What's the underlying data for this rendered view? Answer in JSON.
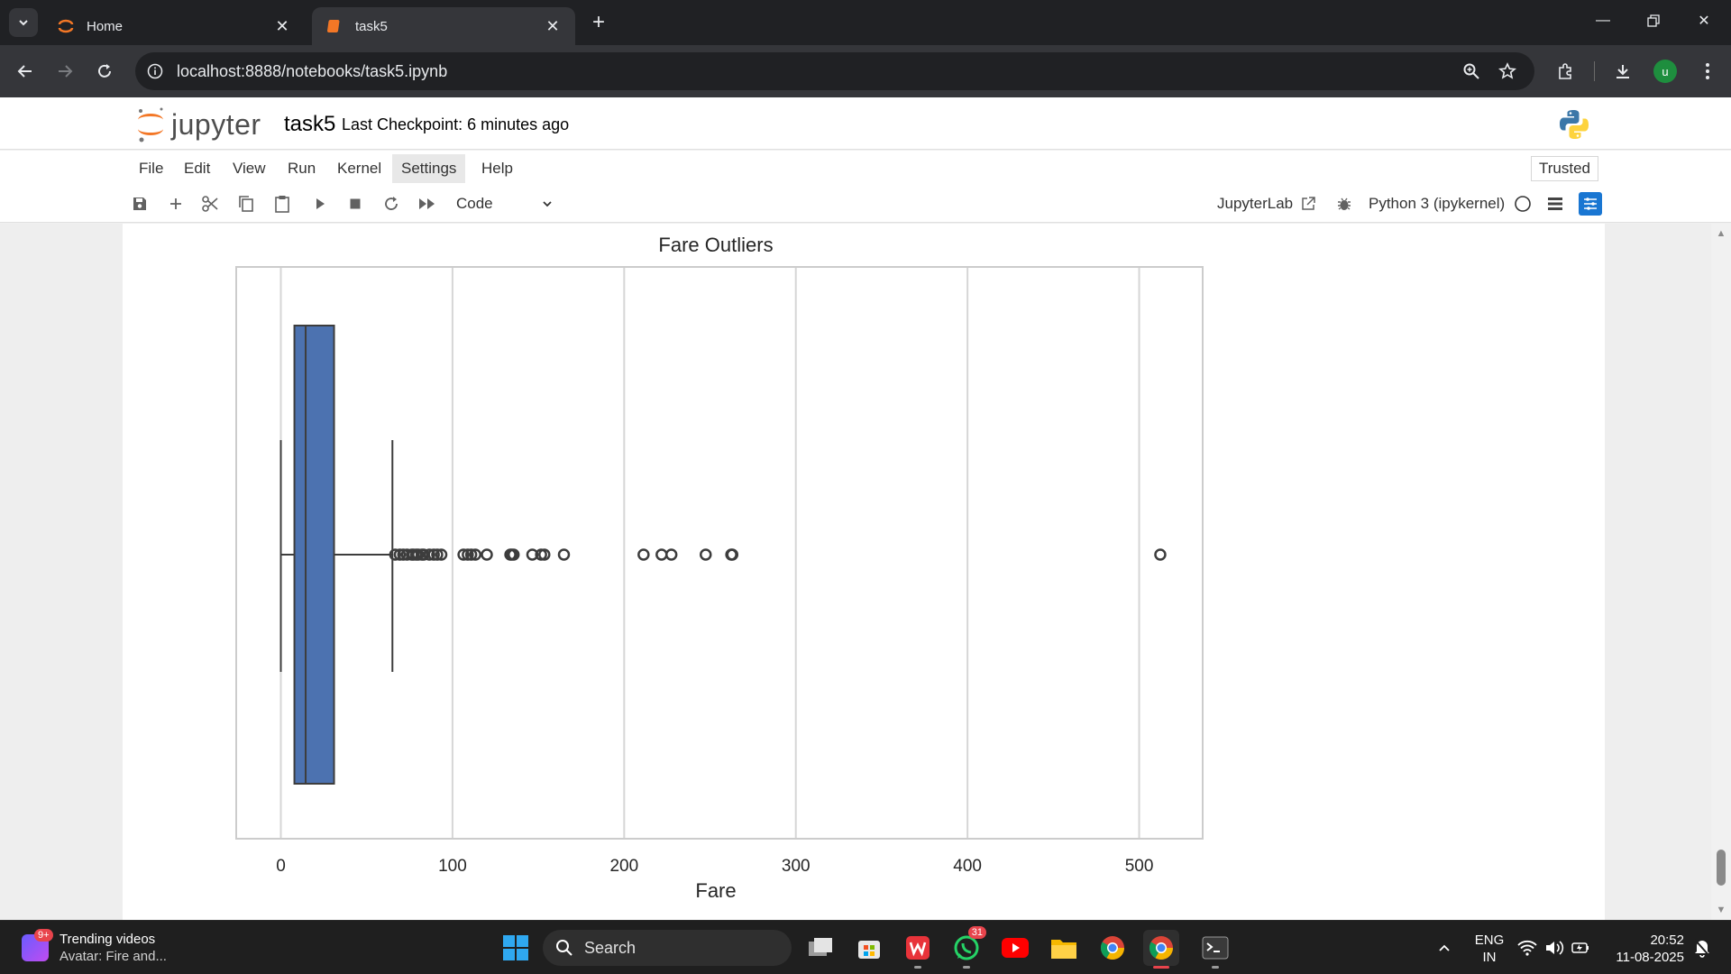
{
  "browser": {
    "tabs": [
      {
        "title": "Home",
        "active": false
      },
      {
        "title": "task5",
        "active": true
      }
    ],
    "url": "localhost:8888/notebooks/task5.ipynb"
  },
  "jupyter": {
    "logo_text": "jupyter",
    "notebook_name": "task5",
    "checkpoint": "Last Checkpoint: 6 minutes ago",
    "menu": [
      "File",
      "Edit",
      "View",
      "Run",
      "Kernel",
      "Settings",
      "Help"
    ],
    "trusted": "Trusted",
    "cell_type": "Code",
    "jupyterlab_label": "JupyterLab",
    "kernel": "Python 3 (ipykernel)"
  },
  "chart_data": {
    "type": "boxplot",
    "title": "Fare Outliers",
    "xlabel": "Fare",
    "ylabel": "",
    "xlim": [
      -26,
      537
    ],
    "xticks": [
      0,
      100,
      200,
      300,
      400,
      500
    ],
    "grid": "vertical",
    "box_color": "#4c72b0",
    "box": {
      "whisker_low": 0,
      "q1": 7.9,
      "median": 14.45,
      "q3": 31.0,
      "whisker_high": 65.0
    },
    "outliers": [
      66.6,
      69.3,
      71.3,
      73.5,
      76.3,
      77.3,
      78.9,
      80.0,
      82.2,
      83.2,
      86.5,
      89.1,
      91.1,
      93.5,
      106.4,
      108.9,
      110.9,
      113.3,
      120.0,
      133.7,
      134.5,
      135.6,
      146.5,
      151.6,
      153.5,
      164.9,
      211.3,
      221.8,
      227.5,
      247.5,
      262.4,
      263.0,
      512.3
    ]
  },
  "taskbar": {
    "widget_title": "Trending videos",
    "widget_sub": "Avatar: Fire and...",
    "widget_badge": "9+",
    "search": "Search",
    "whatsapp_badge": "31",
    "lang1": "ENG",
    "lang2": "IN",
    "time": "20:52",
    "date": "11-08-2025"
  }
}
